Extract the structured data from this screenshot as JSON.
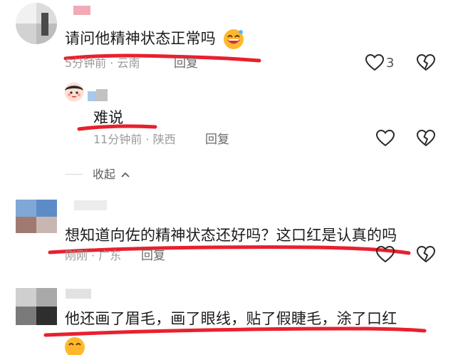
{
  "colors": {
    "underline": "#e8202e",
    "text": "#1b1b1b",
    "meta": "#9a9a9a",
    "icon": "#2a2a2a"
  },
  "comments": [
    {
      "text": "请问他精神状态正常吗",
      "emoji": "grinning-face-emoji",
      "time": "5分钟前",
      "location": "云南",
      "reply_label": "回复",
      "likes": "3"
    },
    {
      "text": "难说",
      "time": "11分钟前",
      "location": "陕西",
      "reply_label": "回复",
      "collapse_label": "收起"
    },
    {
      "text": "想知道向佐的精神状态还好吗？这口红是认真的吗",
      "time": "刚刚",
      "location": "广东",
      "reply_label": "回复"
    },
    {
      "text": "他还画了眉毛，画了眼线，贴了假睫毛，涂了口红",
      "emoji": "grinning-face-emoji"
    }
  ],
  "icons": {
    "like": "heart-outline-icon",
    "dislike": "broken-heart-icon",
    "collapse": "chevron-up-icon"
  }
}
